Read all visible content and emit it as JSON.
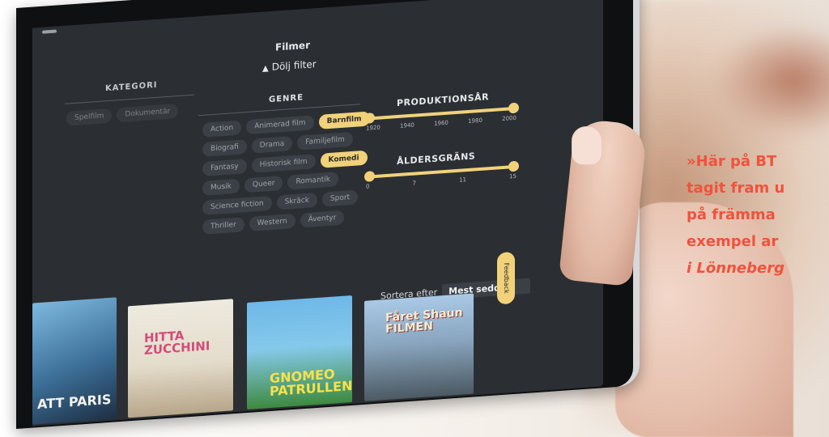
{
  "app": {
    "title": "Filmer",
    "hide_filter": "Dölj filter",
    "hide_filter_icon": "triangle-up-icon"
  },
  "category": {
    "heading": "KATEGORI",
    "options": [
      "Spelfilm",
      "Dokumentär"
    ]
  },
  "genre": {
    "heading": "GENRE",
    "options": [
      {
        "label": "Action",
        "selected": false
      },
      {
        "label": "Animerad film",
        "selected": false
      },
      {
        "label": "Barnfilm",
        "selected": true
      },
      {
        "label": "Biografi",
        "selected": false
      },
      {
        "label": "Drama",
        "selected": false
      },
      {
        "label": "Familjefilm",
        "selected": false
      },
      {
        "label": "Fantasy",
        "selected": false
      },
      {
        "label": "Historisk film",
        "selected": false
      },
      {
        "label": "Komedi",
        "selected": true
      },
      {
        "label": "Musik",
        "selected": false
      },
      {
        "label": "Queer",
        "selected": false
      },
      {
        "label": "Romantik",
        "selected": false
      },
      {
        "label": "Science fiction",
        "selected": false
      },
      {
        "label": "Skräck",
        "selected": false
      },
      {
        "label": "Sport",
        "selected": false
      },
      {
        "label": "Thriller",
        "selected": false
      },
      {
        "label": "Western",
        "selected": false
      },
      {
        "label": "Äventyr",
        "selected": false
      }
    ]
  },
  "production_year": {
    "heading": "PRODUKTIONSÅR",
    "ticks": [
      "1920",
      "1940",
      "1960",
      "1980",
      "2000"
    ],
    "range_fraction": [
      0,
      1
    ]
  },
  "age_limit": {
    "heading": "ÅLDERSGRÄNS",
    "ticks": [
      "0",
      "7",
      "11",
      "15"
    ],
    "range_fraction": [
      0,
      1
    ]
  },
  "sort": {
    "label": "Sortera efter",
    "value": "Mest sedda"
  },
  "feedback_label": "Feedback",
  "posters": [
    {
      "title": "ATT PARIS"
    },
    {
      "title": "HITTA ZUCCHINI"
    },
    {
      "title": "GNOMEO PATRULLEN"
    },
    {
      "title": "Fåret Shaun FILMEN"
    }
  ],
  "quote": {
    "line1": "»Här på BT",
    "line2": "tagit fram u",
    "line3": "på främma",
    "line4": "exempel ar",
    "line5": "i Lönneberg"
  },
  "colors": {
    "accent": "#f1d27a",
    "quote": "#f0523c",
    "screen_bg": "#2b2f33"
  }
}
